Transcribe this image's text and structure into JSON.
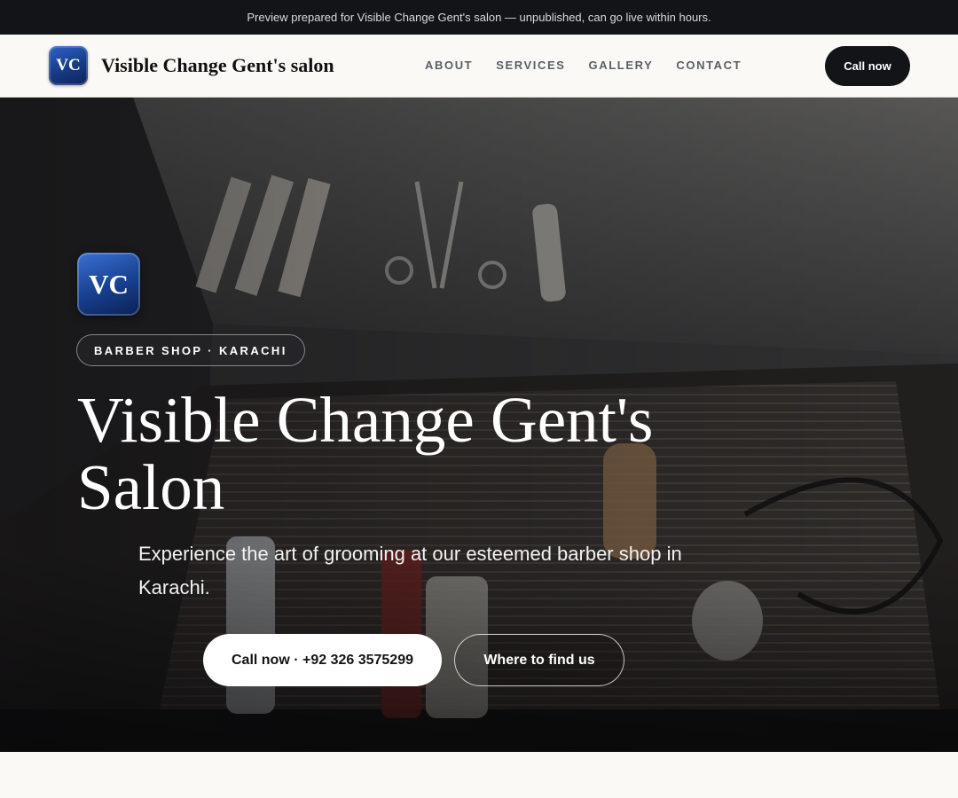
{
  "topbar": {
    "notice": "Preview prepared for Visible Change Gent's salon — unpublished, can go live within hours."
  },
  "nav": {
    "logo_initials": "VC",
    "brand": "Visible Change Gent's salon",
    "links": [
      "ABOUT",
      "SERVICES",
      "GALLERY",
      "CONTACT"
    ],
    "cta_label": "Call now"
  },
  "hero": {
    "badge_initials": "VC",
    "eyebrow": "BARBER SHOP · KARACHI",
    "title_line1": "Visible Change Gent's",
    "title_line2": "Salon",
    "subtitle": "Experience the art of grooming at our esteemed barber shop in Karachi.",
    "primary_button": "Call now · +92 326 3575299",
    "secondary_button": "Where to find us",
    "photo_icon": "barber-tools-photo"
  },
  "colors": {
    "topbar_bg": "#121417",
    "page_bg": "#faf9f6",
    "brand_blue": "#163b86",
    "cta_dark": "#121417"
  }
}
